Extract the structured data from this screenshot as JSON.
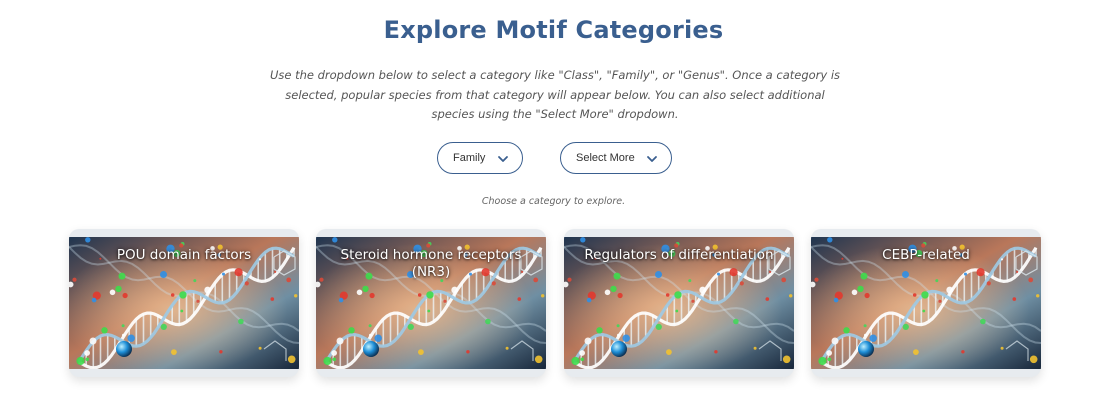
{
  "header": {
    "title": "Explore Motif Categories",
    "intro": "Use the dropdown below to select a category like \"Class\", \"Family\", or \"Genus\". Once a category is selected, popular species from that category will appear below. You can also select additional species using the \"Select More\" dropdown."
  },
  "controls": {
    "category_select": {
      "value": "Family"
    },
    "more_select": {
      "value": "Select More"
    },
    "hint": "Choose a category to explore."
  },
  "cards": [
    {
      "label": "POU domain factors"
    },
    {
      "label": "Steroid hormone receptors (NR3)"
    },
    {
      "label": "Regulators of differentiation"
    },
    {
      "label": "CEBP-related"
    }
  ],
  "colors": {
    "accent": "#3a5f8f",
    "card_bg": "#e7ebef"
  },
  "icons": {
    "dropdown": "chevron-down-icon"
  }
}
